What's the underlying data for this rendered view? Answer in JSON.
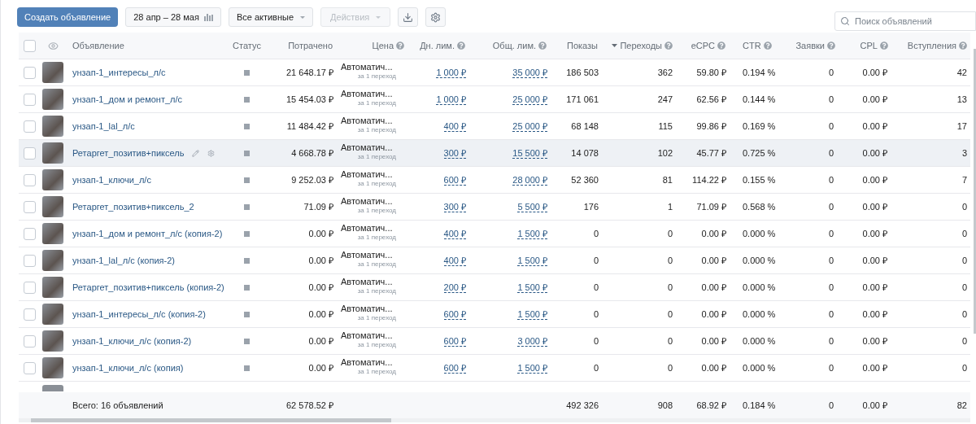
{
  "toolbar": {
    "create_button": "Создать объявление",
    "date_range": "28 апр – 28 мая",
    "filter": "Все активные",
    "actions": {
      "label": "Действия",
      "disabled": true
    },
    "search": {
      "placeholder": "Поиск объявлений"
    }
  },
  "table": {
    "select_all_checked": false,
    "columns": [
      {
        "label": "Объявление",
        "help": false,
        "sorted": false
      },
      {
        "label": "Статус",
        "help": false,
        "sorted": false
      },
      {
        "label": "Потрачено",
        "help": false,
        "sorted": false
      },
      {
        "label": "Цена",
        "help": true,
        "sorted": false
      },
      {
        "label": "Дн. лим.",
        "help": true,
        "sorted": false
      },
      {
        "label": "Общ. лим.",
        "help": true,
        "sorted": false
      },
      {
        "label": "Показы",
        "help": false,
        "sorted": false
      },
      {
        "label": "Переходы",
        "help": true,
        "sorted": true
      },
      {
        "label": "eCPC",
        "help": true,
        "sorted": false
      },
      {
        "label": "CTR",
        "help": true,
        "sorted": false
      },
      {
        "label": "Заявки",
        "help": true,
        "sorted": false
      },
      {
        "label": "CPL",
        "help": true,
        "sorted": false
      },
      {
        "label": "Вступления",
        "help": true,
        "sorted": false
      }
    ],
    "rows": [
      {
        "name": "унзап-1_интересы_л/с",
        "checked": false,
        "hovered": false,
        "spent": "21 648.17 ₽",
        "price": "Автоматич...",
        "price_note": "за 1 переход",
        "daily_limit": "1 000 ₽",
        "total_limit": "35 000 ₽",
        "shows": "186 503",
        "clicks": "362",
        "ecpc": "59.80 ₽",
        "ctr": "0.194 %",
        "leads": "0",
        "cpl": "0.00 ₽",
        "joins": "42"
      },
      {
        "name": "унзап-1_дом и ремонт_л/с",
        "checked": false,
        "hovered": false,
        "spent": "15 454.03 ₽",
        "price": "Автоматич...",
        "price_note": "за 1 переход",
        "daily_limit": "1 000 ₽",
        "total_limit": "25 000 ₽",
        "shows": "171 061",
        "clicks": "247",
        "ecpc": "62.56 ₽",
        "ctr": "0.144 %",
        "leads": "0",
        "cpl": "0.00 ₽",
        "joins": "13"
      },
      {
        "name": "унзап-1_lal_л/с",
        "checked": false,
        "hovered": false,
        "spent": "11 484.42 ₽",
        "price": "Автоматич...",
        "price_note": "за 1 переход",
        "daily_limit": "400 ₽",
        "total_limit": "25 000 ₽",
        "shows": "68 148",
        "clicks": "115",
        "ecpc": "99.86 ₽",
        "ctr": "0.169 %",
        "leads": "0",
        "cpl": "0.00 ₽",
        "joins": "17"
      },
      {
        "name": "Ретаргет_позитив+пиксель",
        "checked": false,
        "hovered": true,
        "spent": "4 668.78 ₽",
        "price": "Автоматич...",
        "price_note": "за 1 переход",
        "daily_limit": "300 ₽",
        "total_limit": "15 500 ₽",
        "shows": "14 078",
        "clicks": "102",
        "ecpc": "45.77 ₽",
        "ctr": "0.725 %",
        "leads": "0",
        "cpl": "0.00 ₽",
        "joins": "3"
      },
      {
        "name": "унзап-1_ключи_л/с",
        "checked": false,
        "hovered": false,
        "spent": "9 252.03 ₽",
        "price": "Автоматич...",
        "price_note": "за 1 переход",
        "daily_limit": "600 ₽",
        "total_limit": "28 000 ₽",
        "shows": "52 360",
        "clicks": "81",
        "ecpc": "114.22 ₽",
        "ctr": "0.155 %",
        "leads": "0",
        "cpl": "0.00 ₽",
        "joins": "7"
      },
      {
        "name": "Ретаргет_позитив+пиксель_2",
        "checked": false,
        "hovered": false,
        "spent": "71.09 ₽",
        "price": "Автоматич...",
        "price_note": "за 1 переход",
        "daily_limit": "300 ₽",
        "total_limit": "5 500 ₽",
        "shows": "176",
        "clicks": "1",
        "ecpc": "71.09 ₽",
        "ctr": "0.568 %",
        "leads": "0",
        "cpl": "0.00 ₽",
        "joins": "0"
      },
      {
        "name": "унзап-1_дом и ремонт_л/с (копия-2)",
        "checked": false,
        "hovered": false,
        "spent": "0.00 ₽",
        "price": "Автоматич...",
        "price_note": "за 1 переход",
        "daily_limit": "400 ₽",
        "total_limit": "1 500 ₽",
        "shows": "0",
        "clicks": "0",
        "ecpc": "0.00 ₽",
        "ctr": "0.000 %",
        "leads": "0",
        "cpl": "0.00 ₽",
        "joins": "0"
      },
      {
        "name": "унзап-1_lal_л/с (копия-2)",
        "checked": false,
        "hovered": false,
        "spent": "0.00 ₽",
        "price": "Автоматич...",
        "price_note": "за 1 переход",
        "daily_limit": "400 ₽",
        "total_limit": "1 500 ₽",
        "shows": "0",
        "clicks": "0",
        "ecpc": "0.00 ₽",
        "ctr": "0.000 %",
        "leads": "0",
        "cpl": "0.00 ₽",
        "joins": "0"
      },
      {
        "name": "Ретаргет_позитив+пиксель (копия-2)",
        "checked": false,
        "hovered": false,
        "spent": "0.00 ₽",
        "price": "Автоматич...",
        "price_note": "за 1 переход",
        "daily_limit": "200 ₽",
        "total_limit": "1 500 ₽",
        "shows": "0",
        "clicks": "0",
        "ecpc": "0.00 ₽",
        "ctr": "0.000 %",
        "leads": "0",
        "cpl": "0.00 ₽",
        "joins": "0"
      },
      {
        "name": "унзап-1_интересы_л/с (копия-2)",
        "checked": false,
        "hovered": false,
        "spent": "0.00 ₽",
        "price": "Автоматич...",
        "price_note": "за 1 переход",
        "daily_limit": "600 ₽",
        "total_limit": "1 500 ₽",
        "shows": "0",
        "clicks": "0",
        "ecpc": "0.00 ₽",
        "ctr": "0.000 %",
        "leads": "0",
        "cpl": "0.00 ₽",
        "joins": "0"
      },
      {
        "name": "унзап-1_ключи_л/с (копия-2)",
        "checked": false,
        "hovered": false,
        "spent": "0.00 ₽",
        "price": "Автоматич...",
        "price_note": "за 1 переход",
        "daily_limit": "600 ₽",
        "total_limit": "3 000 ₽",
        "shows": "0",
        "clicks": "0",
        "ecpc": "0.00 ₽",
        "ctr": "0.000 %",
        "leads": "0",
        "cpl": "0.00 ₽",
        "joins": "0"
      },
      {
        "name": "унзап-1_ключи_л/с (копия)",
        "checked": false,
        "hovered": false,
        "spent": "0.00 ₽",
        "price": "Автоматич...",
        "price_note": "за 1 переход",
        "daily_limit": "600 ₽",
        "total_limit": "1 500 ₽",
        "shows": "0",
        "clicks": "0",
        "ecpc": "0.00 ₽",
        "ctr": "0.000 %",
        "leads": "0",
        "cpl": "0.00 ₽",
        "joins": "0"
      }
    ],
    "footer": {
      "label": "Всего: 16 объявлений",
      "spent": "62 578.52 ₽",
      "shows": "492 326",
      "clicks": "908",
      "ecpc": "68.92 ₽",
      "ctr": "0.184 %",
      "leads": "0",
      "cpl": "0.00 ₽",
      "joins": "82"
    }
  }
}
